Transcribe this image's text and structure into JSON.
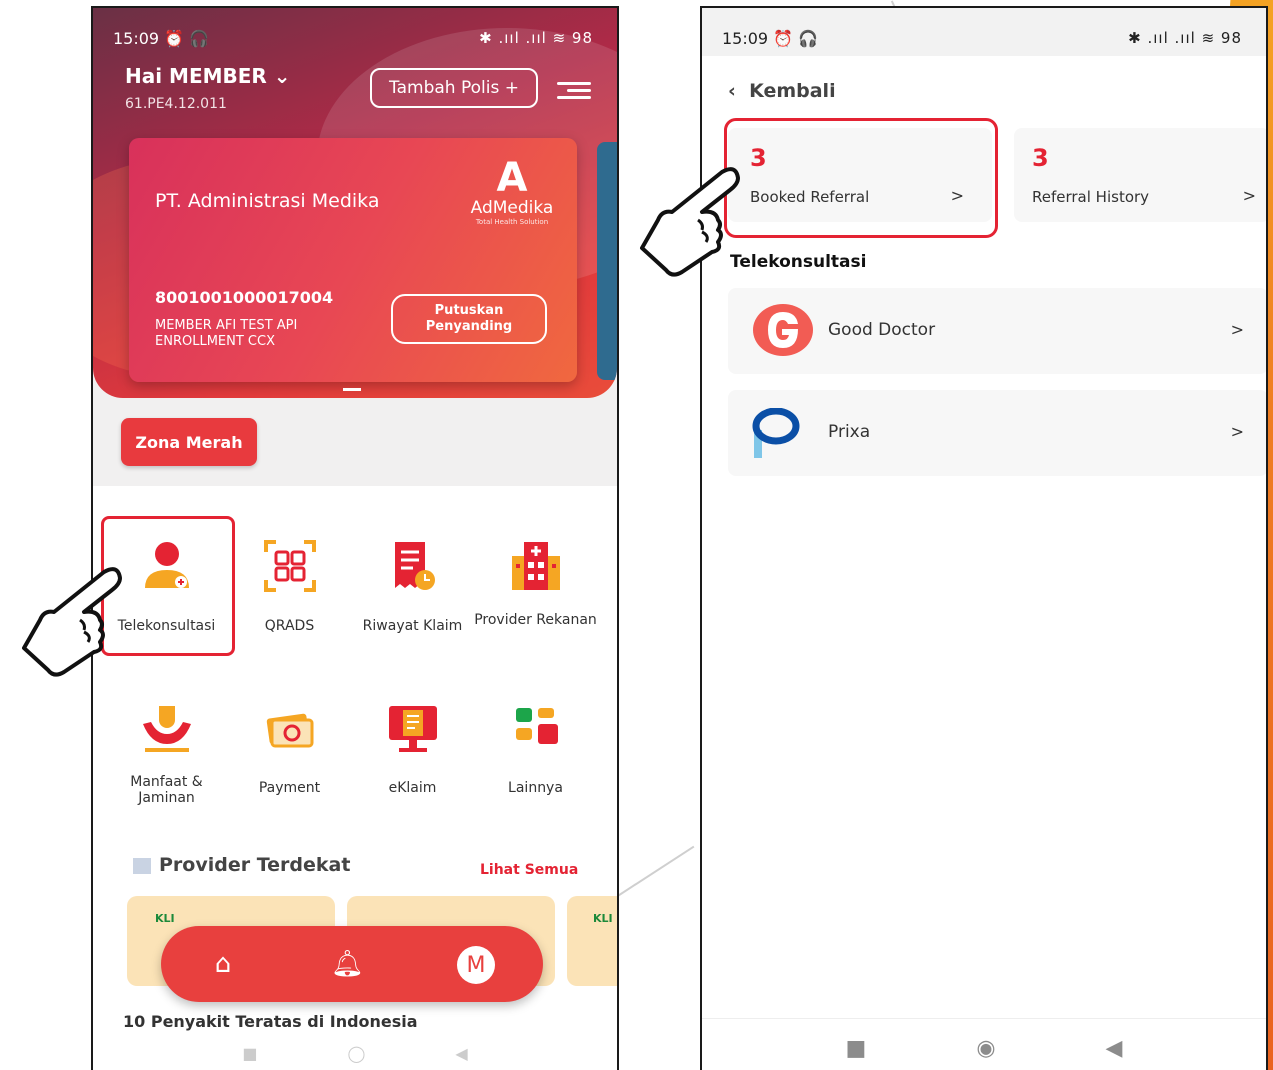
{
  "left_phone": {
    "status_time": "15:09 ⏰ 🎧",
    "status_right": "✱ .ııl .ııl ≋ 98",
    "greeting": "Hai MEMBER ⌄",
    "member_id": "61.PE4.12.011",
    "tambah_polis": "Tambah Polis +",
    "card": {
      "company": "PT. Administrasi Medika",
      "logo_letter": "A",
      "logo_name": "AdMedika",
      "logo_tag": "Total Health Solution",
      "card_number": "8001001000017004",
      "holder": "MEMBER AFI TEST API ENROLLMENT CCX",
      "putuskan": "Putuskan Penyanding"
    },
    "zona_merah": "Zona Merah",
    "menu": [
      {
        "label": "Telekonsultasi"
      },
      {
        "label": "QRADS"
      },
      {
        "label": "Riwayat Klaim"
      },
      {
        "label": "Provider Rekanan"
      },
      {
        "label": "Manfaat & Jaminan"
      },
      {
        "label": "Payment"
      },
      {
        "label": "eKlaim"
      },
      {
        "label": "Lainnya"
      }
    ],
    "provider_title": "Provider Terdekat",
    "lihat_semua": "Lihat Semua",
    "provider_card_label": "KLI",
    "provider_card_label2": "KLI",
    "peek_text": "10 Penyakit Teratas di Indonesia",
    "nav_m": "M"
  },
  "right_phone": {
    "status_time": "15:09 ⏰ 🎧",
    "status_right": "✱ .ııl .ııl ≋ 98",
    "back": "Kembali",
    "booked": {
      "count": "3",
      "label": "Booked Referral"
    },
    "history": {
      "count": "3",
      "label": "Referral History"
    },
    "section_title": "Telekonsultasi",
    "providers": [
      {
        "name": "Good Doctor"
      },
      {
        "name": "Prixa"
      }
    ]
  },
  "colors": {
    "brand_red": "#e42333",
    "accent_orange": "#ef7d22"
  }
}
